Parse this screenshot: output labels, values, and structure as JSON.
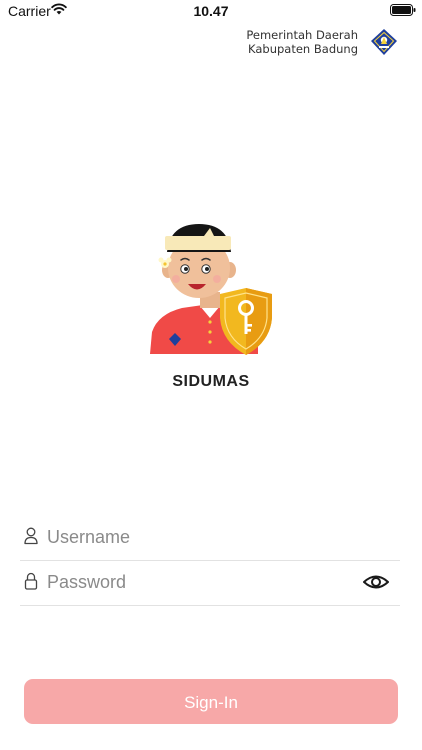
{
  "status_bar": {
    "carrier": "Carrier",
    "time": "10.47",
    "icons": [
      "wifi-icon",
      "battery-icon"
    ]
  },
  "header": {
    "org_line1": "Pemerintah Daerah",
    "org_line2": "Kabupaten Badung",
    "logo_icon": "badung-crest-logo"
  },
  "app": {
    "title": "SIDUMAS",
    "illustration": "balinese-mascot-with-key-shield"
  },
  "login_form": {
    "username": {
      "placeholder": "Username",
      "value": "",
      "icon": "user-icon"
    },
    "password": {
      "placeholder": "Password",
      "value": "",
      "icon": "lock-icon",
      "toggle_icon": "eye-icon"
    },
    "submit_label": "Sign-In"
  },
  "colors": {
    "signin_button": "#f7a8a8",
    "mascot_shirt": "#f04a47",
    "shield": "#f2b81f",
    "crest": "#1f3f9d"
  }
}
